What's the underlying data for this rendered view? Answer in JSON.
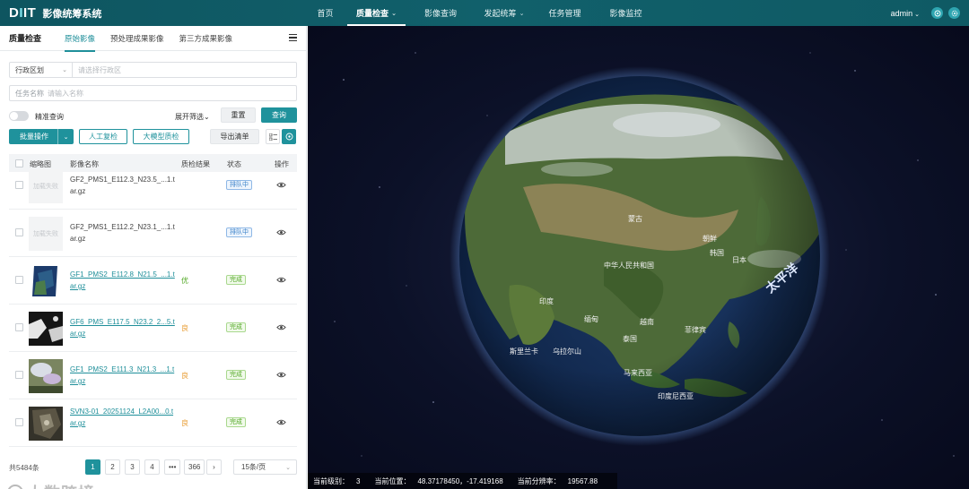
{
  "app": {
    "logo_text_left": "D",
    "logo_text_dot": "I",
    "logo_text_right": "IT",
    "title": "影像统筹系统"
  },
  "nav": {
    "items": [
      {
        "label": "首页",
        "dropdown": false,
        "active": false
      },
      {
        "label": "质量检查",
        "dropdown": true,
        "active": true
      },
      {
        "label": "影像查询",
        "dropdown": false,
        "active": false
      },
      {
        "label": "发起统筹",
        "dropdown": true,
        "active": false
      },
      {
        "label": "任务管理",
        "dropdown": false,
        "active": false
      },
      {
        "label": "影像监控",
        "dropdown": false,
        "active": false
      }
    ],
    "user": "admin"
  },
  "panel": {
    "title": "质量检查",
    "tabs": [
      "原始影像",
      "预处理成果影像",
      "第三方成果影像"
    ],
    "active_tab": 0
  },
  "filters": {
    "region_select": "行政区划",
    "region_placeholder": "请选择行政区",
    "task_label": "任务名称",
    "task_placeholder": "请输入名称",
    "exact_label": "精准查询",
    "expand_label": "展开筛选",
    "reset_label": "重置",
    "query_label": "查询"
  },
  "actions": {
    "batch_label": "批量操作",
    "manual_label": "人工复检",
    "bigmodel_label": "大模型质检",
    "export_label": "导出清单"
  },
  "table": {
    "headers": [
      "缩略图",
      "影像名称",
      "质检结果",
      "状态",
      "操作"
    ],
    "rows": [
      {
        "thumb": "加载失败",
        "name": "GF2_PMS1_E112.3_N23.5_...1.tar.gz",
        "link": false,
        "result": "",
        "status": "排队中"
      },
      {
        "thumb": "加载失败",
        "name": "GF2_PMS1_E112.2_N23.1_...1.tar.gz",
        "link": false,
        "result": "",
        "status": "排队中"
      },
      {
        "thumb": "",
        "name": "GF1_PMS2_E112.8_N21.5_...1.tar.gz",
        "link": true,
        "result": "优",
        "status": "完成"
      },
      {
        "thumb": "",
        "name": "GF6_PMS_E117.5_N23.2_2...5.tar.gz",
        "link": true,
        "result": "良",
        "status": "完成"
      },
      {
        "thumb": "",
        "name": "GF1_PMS2_E111.3_N21.3_...1.tar.gz",
        "link": true,
        "result": "良",
        "status": "完成"
      },
      {
        "thumb": "",
        "name": "SVN3-01_20251124_L2A00...0.tar.gz",
        "link": true,
        "result": "良",
        "status": "完成"
      }
    ]
  },
  "pagination": {
    "total": "共5484条",
    "pages": [
      "1",
      "2",
      "3",
      "4",
      "•••",
      "366"
    ],
    "active_page": "1",
    "next": "›",
    "page_size": "15条/页"
  },
  "watermark": "大数跨境",
  "map": {
    "labels": [
      "中华人民共和国",
      "蒙古",
      "印度",
      "缅甸",
      "越南",
      "泰国",
      "菲律宾",
      "马来西亚",
      "印度尼西亚",
      "日本",
      "朝鲜",
      "韩国",
      "乌拉尔山",
      "太平洋",
      "斯里兰卡"
    ],
    "ocean_label": "太平洋",
    "status_level_label": "当前级别：",
    "status_level": "3",
    "status_pos_label": "当前位置：",
    "status_pos": "48.37178450，-17.419168",
    "status_res_label": "当前分辨率：",
    "status_res": "19567.88"
  }
}
